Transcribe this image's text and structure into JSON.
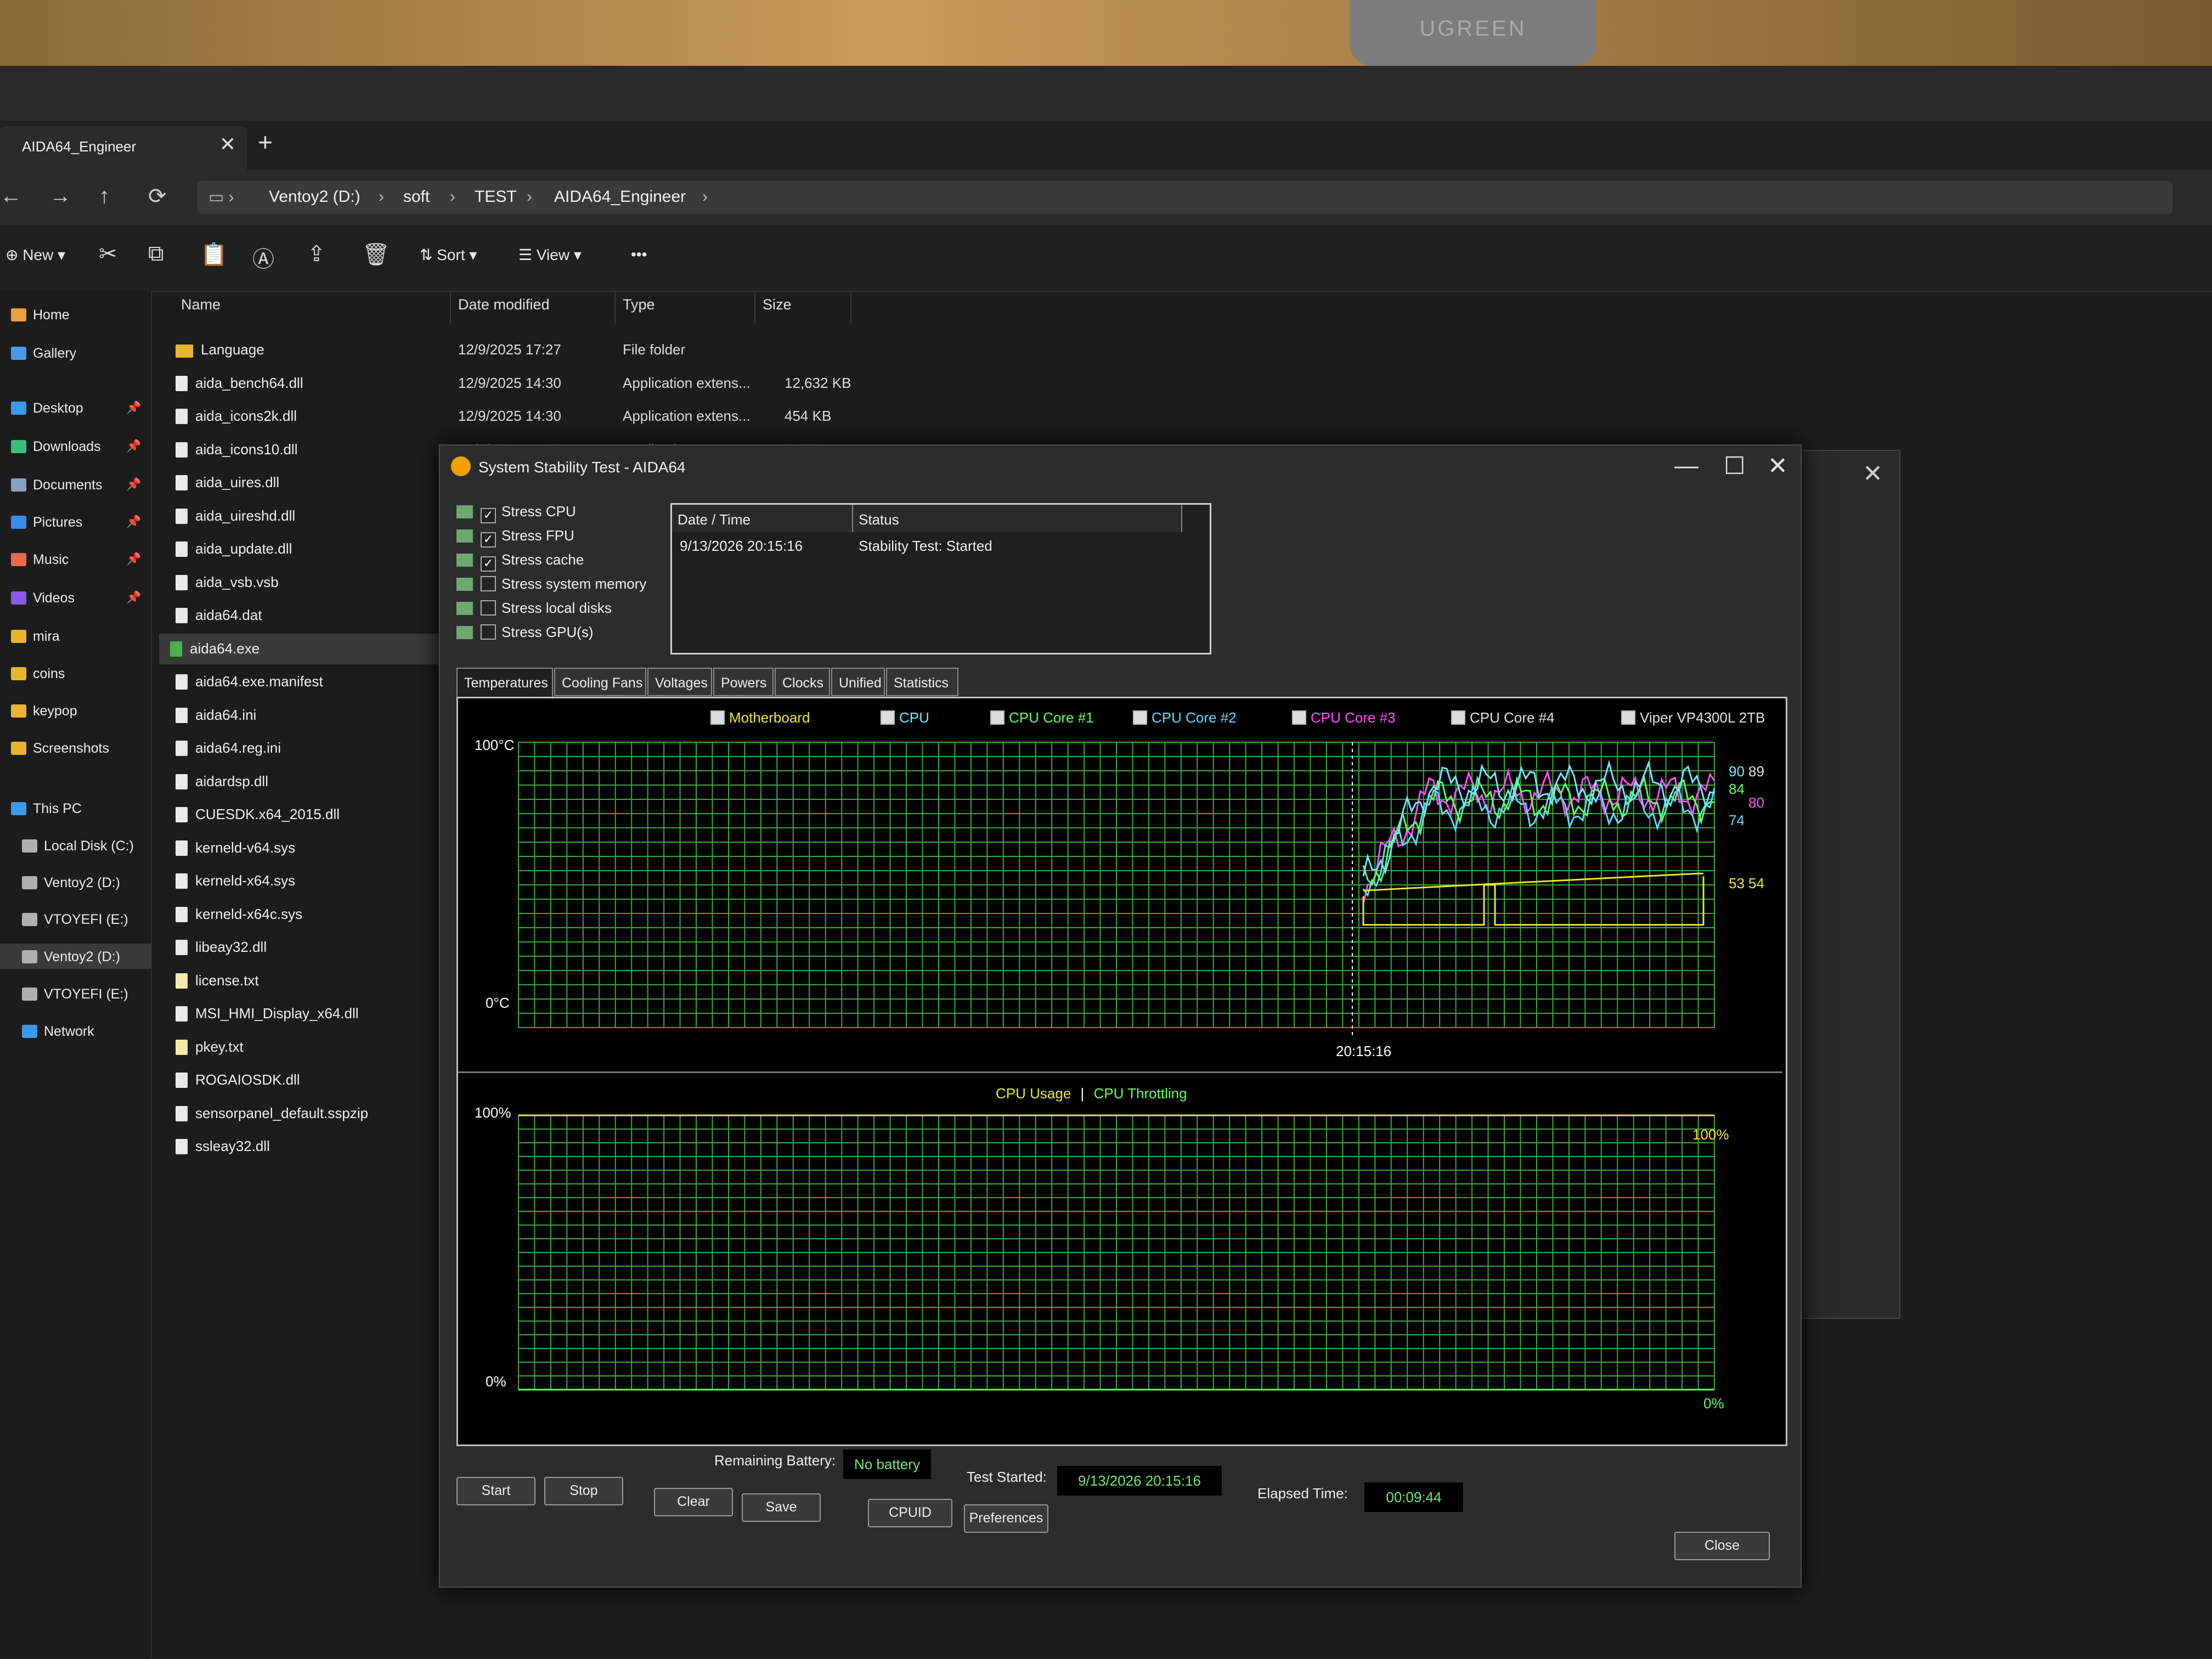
{
  "webcam": {
    "brand": "UGREEN"
  },
  "explorer": {
    "tab_title": "AIDA64_Engineer",
    "tab_close": "✕",
    "new_tab": "+",
    "nav": {
      "back": "←",
      "forward": "→",
      "up": "↑",
      "refresh": "⟳"
    },
    "breadcrumbs": [
      "Ventoy2 (D:)",
      "soft",
      "TEST",
      "AIDA64_Engineer"
    ],
    "toolbar": {
      "new": "New",
      "sort": "Sort",
      "view": "View",
      "more": "•••"
    },
    "sidebar": [
      {
        "label": "Home",
        "icon": "home-icon"
      },
      {
        "label": "Gallery",
        "icon": "gallery-icon"
      },
      {
        "label": "Desktop",
        "icon": "desktop-icon",
        "pinned": true
      },
      {
        "label": "Downloads",
        "icon": "download-icon",
        "pinned": true
      },
      {
        "label": "Documents",
        "icon": "documents-icon",
        "pinned": true
      },
      {
        "label": "Pictures",
        "icon": "pictures-icon",
        "pinned": true
      },
      {
        "label": "Music",
        "icon": "music-icon",
        "pinned": true
      },
      {
        "label": "Videos",
        "icon": "videos-icon",
        "pinned": true
      },
      {
        "label": "mira",
        "icon": "folder-icon"
      },
      {
        "label": "coins",
        "icon": "folder-icon"
      },
      {
        "label": "keypop",
        "icon": "folder-icon"
      },
      {
        "label": "Screenshots",
        "icon": "folder-icon"
      },
      {
        "label": "This PC",
        "icon": "pc-icon"
      },
      {
        "label": "Local Disk (C:)",
        "icon": "drive-icon"
      },
      {
        "label": "Ventoy2 (D:)",
        "icon": "drive-icon"
      },
      {
        "label": "VTOYEFI (E:)",
        "icon": "drive-icon"
      },
      {
        "label": "Ventoy2 (D:)",
        "icon": "drive-icon"
      },
      {
        "label": "VTOYEFI (E:)",
        "icon": "drive-icon"
      },
      {
        "label": "Network",
        "icon": "network-icon"
      }
    ],
    "columns": {
      "name": "Name",
      "date": "Date modified",
      "type": "Type",
      "size": "Size"
    },
    "files": [
      {
        "name": "Language",
        "date": "12/9/2025 17:27",
        "type": "File folder",
        "size": "",
        "kind": "folder"
      },
      {
        "name": "aida_bench64.dll",
        "date": "12/9/2025 14:30",
        "type": "Application extens...",
        "size": "12,632 KB",
        "kind": "file"
      },
      {
        "name": "aida_icons2k.dll",
        "date": "12/9/2025 14:30",
        "type": "Application extens...",
        "size": "454 KB",
        "kind": "file"
      },
      {
        "name": "aida_icons10.dll",
        "date": "12/9/2025 14:30",
        "type": "Application extens...",
        "size": "9,309 KB",
        "kind": "file"
      },
      {
        "name": "aida_uires.dll",
        "date": "",
        "type": "",
        "size": "",
        "kind": "file"
      },
      {
        "name": "aida_uireshd.dll",
        "date": "",
        "type": "",
        "size": "",
        "kind": "file"
      },
      {
        "name": "aida_update.dll",
        "date": "",
        "type": "",
        "size": "",
        "kind": "file"
      },
      {
        "name": "aida_vsb.vsb",
        "date": "",
        "type": "",
        "size": "",
        "kind": "file"
      },
      {
        "name": "aida64.dat",
        "date": "",
        "type": "",
        "size": "",
        "kind": "file"
      },
      {
        "name": "aida64.exe",
        "date": "",
        "type": "",
        "size": "",
        "kind": "exe"
      },
      {
        "name": "aida64.exe.manifest",
        "date": "",
        "type": "",
        "size": "",
        "kind": "file"
      },
      {
        "name": "aida64.ini",
        "date": "",
        "type": "",
        "size": "",
        "kind": "file"
      },
      {
        "name": "aida64.reg.ini",
        "date": "",
        "type": "",
        "size": "",
        "kind": "file"
      },
      {
        "name": "aidardsp.dll",
        "date": "",
        "type": "",
        "size": "",
        "kind": "file"
      },
      {
        "name": "CUESDK.x64_2015.dll",
        "date": "",
        "type": "",
        "size": "",
        "kind": "file"
      },
      {
        "name": "kerneld-v64.sys",
        "date": "",
        "type": "",
        "size": "",
        "kind": "file"
      },
      {
        "name": "kerneld-x64.sys",
        "date": "",
        "type": "",
        "size": "",
        "kind": "file"
      },
      {
        "name": "kerneld-x64c.sys",
        "date": "",
        "type": "",
        "size": "",
        "kind": "file"
      },
      {
        "name": "libeay32.dll",
        "date": "",
        "type": "",
        "size": "",
        "kind": "file"
      },
      {
        "name": "license.txt",
        "date": "",
        "type": "",
        "size": "",
        "kind": "txt"
      },
      {
        "name": "MSI_HMI_Display_x64.dll",
        "date": "",
        "type": "",
        "size": "",
        "kind": "file"
      },
      {
        "name": "pkey.txt",
        "date": "",
        "type": "",
        "size": "",
        "kind": "txt"
      },
      {
        "name": "ROGAIOSDK.dll",
        "date": "",
        "type": "",
        "size": "",
        "kind": "file"
      },
      {
        "name": "sensorpanel_default.sspzip",
        "date": "",
        "type": "",
        "size": "",
        "kind": "file"
      },
      {
        "name": "ssleay32.dll",
        "date": "",
        "type": "",
        "size": "",
        "kind": "file"
      }
    ]
  },
  "aida": {
    "title": "System Stability Test - AIDA64",
    "window_buttons": {
      "minimize": "—",
      "maximize": "☐",
      "close": "✕"
    },
    "stress_options": [
      {
        "label": "Stress CPU",
        "checked": true
      },
      {
        "label": "Stress FPU",
        "checked": true
      },
      {
        "label": "Stress cache",
        "checked": true
      },
      {
        "label": "Stress system memory",
        "checked": false
      },
      {
        "label": "Stress local disks",
        "checked": false
      },
      {
        "label": "Stress GPU(s)",
        "checked": false
      }
    ],
    "log": {
      "col_datetime": "Date / Time",
      "col_status": "Status",
      "rows": [
        {
          "datetime": "9/13/2026 20:15:16",
          "status": "Stability Test: Started"
        }
      ]
    },
    "tabs": [
      "Temperatures",
      "Cooling Fans",
      "Voltages",
      "Powers",
      "Clocks",
      "Unified",
      "Statistics"
    ],
    "temp_legend": [
      {
        "label": "Motherboard",
        "color": "#e8e830"
      },
      {
        "label": "CPU",
        "color": "#6fe8ff"
      },
      {
        "label": "CPU Core #1",
        "color": "#5fff5f"
      },
      {
        "label": "CPU Core #2",
        "color": "#5fd8ff"
      },
      {
        "label": "CPU Core #3",
        "color": "#ff4fff"
      },
      {
        "label": "CPU Core #4",
        "color": "#e0e0e0"
      },
      {
        "label": "Viper VP4300L 2TB",
        "color": "#e0e0e0"
      }
    ],
    "temp_axis": {
      "top": "100°C",
      "bottom": "0°C",
      "time": "20:15:16"
    },
    "temp_values": [
      {
        "text": "90",
        "color": "#6fe8ff"
      },
      {
        "text": "89",
        "color": "#e0e0e0"
      },
      {
        "text": "84",
        "color": "#5fff5f"
      },
      {
        "text": "80",
        "color": "#ff4fff"
      },
      {
        "text": "74",
        "color": "#5fd8ff"
      },
      {
        "text": "53",
        "color": "#e8e830"
      },
      {
        "text": "54",
        "color": "#e8e830"
      }
    ],
    "usage_legend": {
      "usage": "CPU Usage",
      "sep": "|",
      "throttling": "CPU Throttling",
      "usage_color": "#e8e830",
      "throttling_color": "#5fff5f"
    },
    "usage_axis": {
      "top": "100%",
      "bottom": "0%",
      "usage_value": "100%",
      "throttle_value": "0%"
    },
    "bottom": {
      "start": "Start",
      "stop": "Stop",
      "clear": "Clear",
      "save": "Save",
      "cpuid": "CPUID",
      "preferences": "Preferences",
      "close": "Close",
      "remaining_battery_label": "Remaining Battery:",
      "remaining_battery": "No battery",
      "test_started_label": "Test Started:",
      "test_started": "9/13/2026 20:15:16",
      "elapsed_label": "Elapsed Time:",
      "elapsed": "00:09:44"
    }
  },
  "colors": {
    "graph_grid": "#3fa83f",
    "graph_bg": "#000000",
    "accent_green": "#6fe86f"
  }
}
